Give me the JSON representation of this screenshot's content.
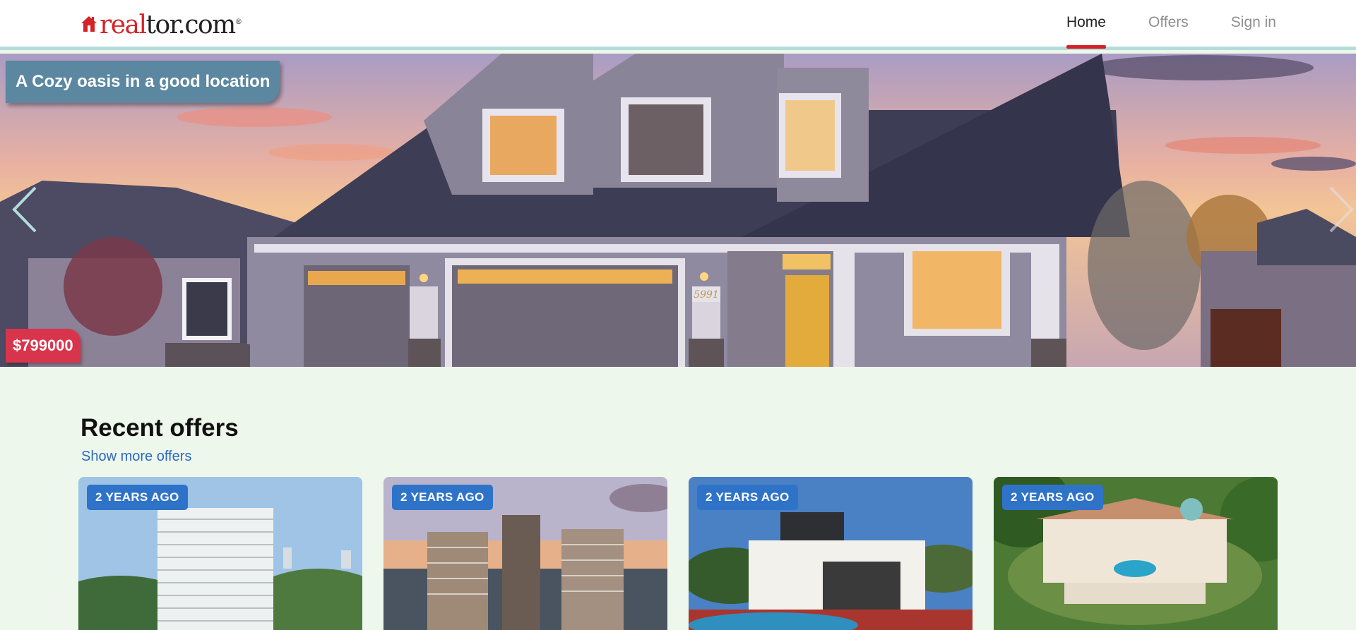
{
  "brand": {
    "logo_red": "real",
    "logo_dark": "tor.com",
    "logo_tm": "®",
    "color_red": "#d52228"
  },
  "nav": {
    "items": [
      {
        "label": "Home",
        "active": true
      },
      {
        "label": "Offers",
        "active": false
      },
      {
        "label": "Sign in",
        "active": false
      }
    ]
  },
  "hero": {
    "title": "A Cozy oasis in a good location",
    "price": "$799000",
    "house_number": "5991",
    "prev_icon": "chevron-left-icon",
    "next_icon": "chevron-right-icon"
  },
  "recent": {
    "title": "Recent offers",
    "show_more": "Show more offers",
    "cards": [
      {
        "badge": "2 YEARS AGO",
        "image": "white-highrise-tower"
      },
      {
        "badge": "2 YEARS AGO",
        "image": "apartment-towers-sunset"
      },
      {
        "badge": "2 YEARS AGO",
        "image": "modern-house-pool"
      },
      {
        "badge": "2 YEARS AGO",
        "image": "mansion-aerial-view"
      }
    ]
  },
  "colors": {
    "page_bg": "#eef7ec",
    "accent_blue": "#2f73c9",
    "title_badge": "#5b87a1",
    "price_badge": "#d8354c",
    "header_underline": "#b3dcd8"
  }
}
